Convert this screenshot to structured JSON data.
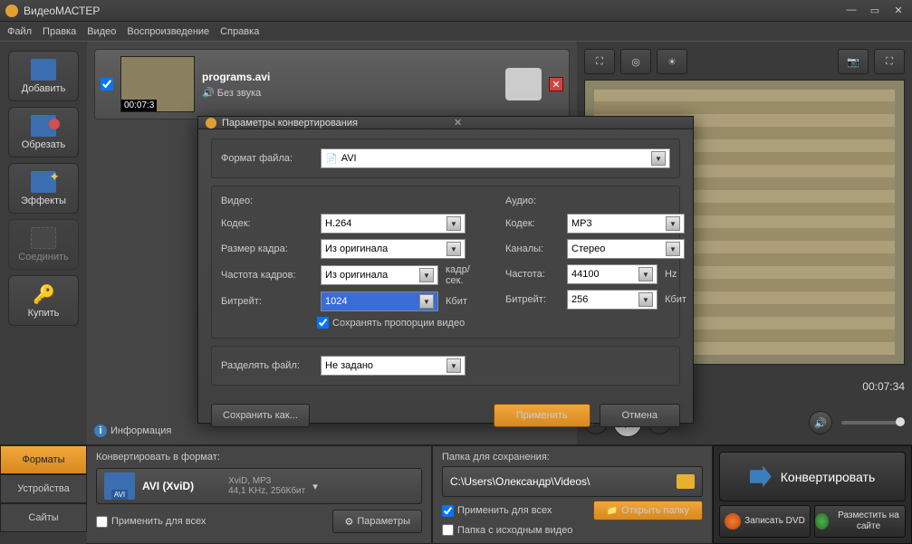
{
  "app": {
    "title": "ВидеоМАСТЕР"
  },
  "menu": [
    "Файл",
    "Правка",
    "Видео",
    "Воспроизведение",
    "Справка"
  ],
  "sidebar": [
    {
      "label": "Добавить",
      "icon": "add"
    },
    {
      "label": "Обрезать",
      "icon": "cut"
    },
    {
      "label": "Эффекты",
      "icon": "fx"
    },
    {
      "label": "Соединить",
      "icon": "join",
      "disabled": true
    },
    {
      "label": "Купить",
      "icon": "buy"
    }
  ],
  "file": {
    "name": "programs.avi",
    "audio": "Без звука",
    "timecode": "00:07:3"
  },
  "info_label": "Информация",
  "preview": {
    "time": "00:07:34"
  },
  "tabs": [
    "Форматы",
    "Устройства",
    "Сайты"
  ],
  "convert_panel": {
    "title": "Конвертировать в формат:",
    "format_name": "AVI (XviD)",
    "format_badge": "AVI",
    "format_line1": "XviD, MP3",
    "format_line2": "44,1 KHz, 256Кбит",
    "apply_all": "Применить для всех",
    "params_btn": "Параметры"
  },
  "save_panel": {
    "title": "Папка для сохранения:",
    "path": "C:\\Users\\Олександр\\Videos\\",
    "apply_all": "Применить для всех",
    "same_folder": "Папка с исходным видео",
    "open_btn": "Открыть папку"
  },
  "action": {
    "convert": "Конвертировать",
    "dvd": "Записать DVD",
    "web": "Разместить на сайте"
  },
  "dialog": {
    "title": "Параметры конвертирования",
    "file_format_lbl": "Формат файла:",
    "file_format": "AVI",
    "video_hdr": "Видео:",
    "audio_hdr": "Аудио:",
    "codec_lbl": "Кодек:",
    "v_codec": "H.264",
    "size_lbl": "Размер кадра:",
    "size": "Из оригинала",
    "fps_lbl": "Частота кадров:",
    "fps": "Из оригинала",
    "fps_unit": "кадр/сек.",
    "bitrate_lbl": "Битрейт:",
    "v_bitrate": "1024",
    "bitrate_unit": "Кбит",
    "keep_aspect": "Сохранять пропорции видео",
    "a_codec": "MP3",
    "channels_lbl": "Каналы:",
    "channels": "Стерео",
    "freq_lbl": "Частота:",
    "freq": "44100",
    "freq_unit": "Hz",
    "a_bitrate": "256",
    "split_lbl": "Разделять файл:",
    "split": "Не задано",
    "save_as": "Сохранить как...",
    "apply": "Применить",
    "cancel": "Отмена"
  }
}
